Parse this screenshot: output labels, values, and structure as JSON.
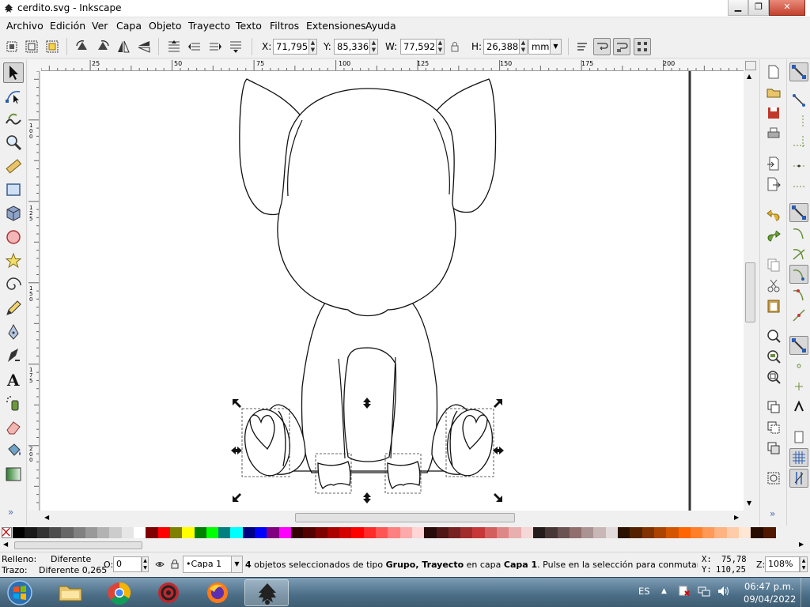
{
  "window": {
    "title": "cerdito.svg - Inkscape"
  },
  "menu": [
    "Archivo",
    "Edición",
    "Ver",
    "Capa",
    "Objeto",
    "Trayecto",
    "Texto",
    "Filtros",
    "Extensiones",
    "Ayuda"
  ],
  "controls": {
    "x_label": "X:",
    "x_value": "71,795",
    "y_label": "Y:",
    "y_value": "85,336",
    "w_label": "W:",
    "w_value": "77,592",
    "h_label": "H:",
    "h_value": "26,388",
    "unit": "mm"
  },
  "tools": [
    "selector-tool",
    "node-tool",
    "tweak-tool",
    "zoom-tool",
    "measure-tool",
    "rectangle-tool",
    "box3d-tool",
    "ellipse-tool",
    "star-tool",
    "spiral-tool",
    "pencil-tool",
    "pen-tool",
    "calligraphy-tool",
    "text-tool",
    "spray-tool",
    "eraser-tool",
    "paint-bucket-tool",
    "gradient-tool"
  ],
  "hruler_labels": [
    {
      "text": "25"
    },
    {
      "text": "50"
    },
    {
      "text": "75"
    },
    {
      "text": "100"
    },
    {
      "text": "125"
    },
    {
      "text": "150"
    },
    {
      "text": "175"
    },
    {
      "text": "200"
    }
  ],
  "vruler_labels": [
    "100",
    "125",
    "150",
    "175",
    "200"
  ],
  "palette": [
    "#000000",
    "#1a1a1a",
    "#333333",
    "#4d4d4d",
    "#666666",
    "#808080",
    "#999999",
    "#b3b3b3",
    "#cccccc",
    "#e6e6e6",
    "#ffffff",
    "#800000",
    "#ff0000",
    "#808000",
    "#ffff00",
    "#008000",
    "#00ff00",
    "#008080",
    "#00ffff",
    "#000080",
    "#0000ff",
    "#800080",
    "#ff00ff",
    "#330000",
    "#550000",
    "#800000",
    "#aa0000",
    "#d40000",
    "#ff0000",
    "#ff2a2a",
    "#ff5555",
    "#ff8080",
    "#ffaaaa",
    "#ffd5d5",
    "#280b0b",
    "#501616",
    "#782121",
    "#a02c2c",
    "#c83737",
    "#d35f5f",
    "#de8787",
    "#e9afaf",
    "#f4d7d7",
    "#241c1c",
    "#483737",
    "#6c5353",
    "#916f6f",
    "#ac9393",
    "#c8b7b7",
    "#e3dbdb",
    "#2b1100",
    "#552200",
    "#803300",
    "#aa4400",
    "#d45500",
    "#ff6600",
    "#ff7f2a",
    "#ff9955",
    "#ffb380",
    "#ffccaa",
    "#ffe6d5",
    "#280b00",
    "#501600"
  ],
  "status": {
    "fill_label": "Relleno:",
    "fill_value": "Diferente",
    "stroke_label": "Trazo:",
    "stroke_value": "Diferente 0,265",
    "opacity_label": "O:",
    "opacity_value": "0",
    "layer": "•Capa 1",
    "message_count": "4",
    "message_p1": " objetos seleccionados de tipo ",
    "message_b1": "Grupo, Trayecto",
    "message_p2": " en capa ",
    "message_b2": "Capa 1",
    "message_p3": ". Pulse en la selección para conmutar los t...",
    "cursor_x_label": "X:",
    "cursor_x": "75,78",
    "cursor_y_label": "Y:",
    "cursor_y": "110,25",
    "zoom_label": "Z:",
    "zoom": "108%"
  },
  "taskbar": {
    "language": "ES",
    "time": "06:47 p.m.",
    "date": "09/04/2022",
    "apps": [
      "start-button",
      "file-explorer",
      "chrome",
      "app-red",
      "firefox",
      "inkscape"
    ]
  }
}
